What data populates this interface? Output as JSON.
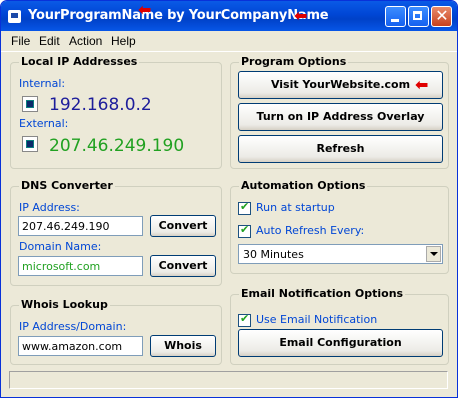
{
  "title": "YourProgramName by YourCompanyName",
  "menu": [
    "File",
    "Edit",
    "Action",
    "Help"
  ],
  "local_ip": {
    "legend": "Local IP Addresses",
    "internal_label": "Internal:",
    "internal_value": "192.168.0.2",
    "external_label": "External:",
    "external_value": "207.46.249.190"
  },
  "program_options": {
    "legend": "Program Options",
    "visit_label": "Visit YourWebsite.com",
    "overlay_label": "Turn on IP Address Overlay",
    "refresh_label": "Refresh"
  },
  "dns": {
    "legend": "DNS Converter",
    "ip_label": "IP Address:",
    "ip_value": "207.46.249.190",
    "ip_convert": "Convert",
    "domain_label": "Domain Name:",
    "domain_value": "microsoft.com",
    "domain_convert": "Convert"
  },
  "automation": {
    "legend": "Automation Options",
    "run_startup_label": "Run at startup",
    "run_startup_checked": true,
    "auto_refresh_label": "Auto Refresh Every:",
    "auto_refresh_checked": true,
    "interval_value": "30 Minutes"
  },
  "whois": {
    "legend": "Whois Lookup",
    "field_label": "IP Address/Domain:",
    "field_value": "www.amazon.com",
    "button_label": "Whois"
  },
  "email": {
    "legend": "Email Notification Options",
    "use_email_label": "Use Email Notification",
    "use_email_checked": true,
    "config_label": "Email Configuration"
  },
  "icons": [
    "app-icon",
    "minimize-icon",
    "maximize-icon",
    "close-icon",
    "network-icon",
    "checkmark-icon",
    "dropdown-arrow-icon",
    "red-arrow-annotation"
  ],
  "colors": {
    "internal_ip": "#1d1d9b",
    "external_ip": "#21a121",
    "domain_text": "#21a121",
    "title_bar": "#0046d5",
    "annotation_arrow": "#e00000"
  }
}
